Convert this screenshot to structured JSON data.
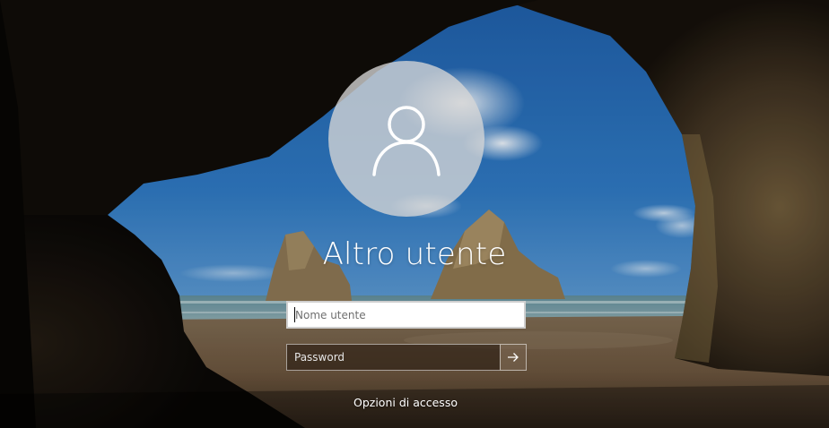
{
  "login": {
    "user_name": "Altro utente",
    "username": {
      "placeholder": "Nome utente",
      "value": ""
    },
    "password": {
      "placeholder": "Password",
      "value": ""
    },
    "submit_icon": "arrow-right-icon",
    "signin_options_label": "Opzioni di accesso"
  },
  "background": {
    "description_icon": "cave-beach-wallpaper"
  },
  "colors": {
    "text": "#ffffff",
    "avatar_circle": "#d6d6d6",
    "username_bg": "#ffffff",
    "password_bg": "#281c12"
  }
}
